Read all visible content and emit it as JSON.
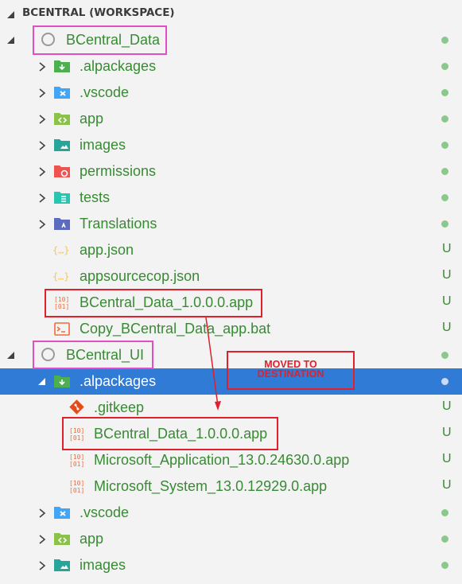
{
  "header": {
    "title": "BCENTRAL (WORKSPACE)"
  },
  "rows": [
    {
      "label": "BCentral_Data",
      "status": "dot"
    },
    {
      "label": ".alpackages",
      "status": "dot"
    },
    {
      "label": ".vscode",
      "status": "dot"
    },
    {
      "label": "app",
      "status": "dot"
    },
    {
      "label": "images",
      "status": "dot"
    },
    {
      "label": "permissions",
      "status": "dot"
    },
    {
      "label": "tests",
      "status": "dot"
    },
    {
      "label": "Translations",
      "status": "dot"
    },
    {
      "label": "app.json",
      "status": "U"
    },
    {
      "label": "appsourcecop.json",
      "status": "U"
    },
    {
      "label": "BCentral_Data_1.0.0.0.app",
      "status": "U"
    },
    {
      "label": "Copy_BCentral_Data_app.bat",
      "status": "U"
    },
    {
      "label": "BCentral_UI",
      "status": "dot"
    },
    {
      "label": ".alpackages",
      "status": "dot"
    },
    {
      "label": ".gitkeep",
      "status": "U"
    },
    {
      "label": "BCentral_Data_1.0.0.0.app",
      "status": "U"
    },
    {
      "label": "Microsoft_Application_13.0.24630.0.app",
      "status": "U"
    },
    {
      "label": "Microsoft_System_13.0.12929.0.app",
      "status": "U"
    },
    {
      "label": ".vscode",
      "status": "dot"
    },
    {
      "label": "app",
      "status": "dot"
    },
    {
      "label": "images",
      "status": "dot"
    }
  ],
  "annotation": {
    "callout_line1": "MOVED TO",
    "callout_line2": "DESTINATION"
  },
  "colors": {
    "selected": "#2f7bd6",
    "file_text": "#388a34",
    "annotation_red": "#e0202a",
    "annotation_pink": "#e24fc0"
  }
}
